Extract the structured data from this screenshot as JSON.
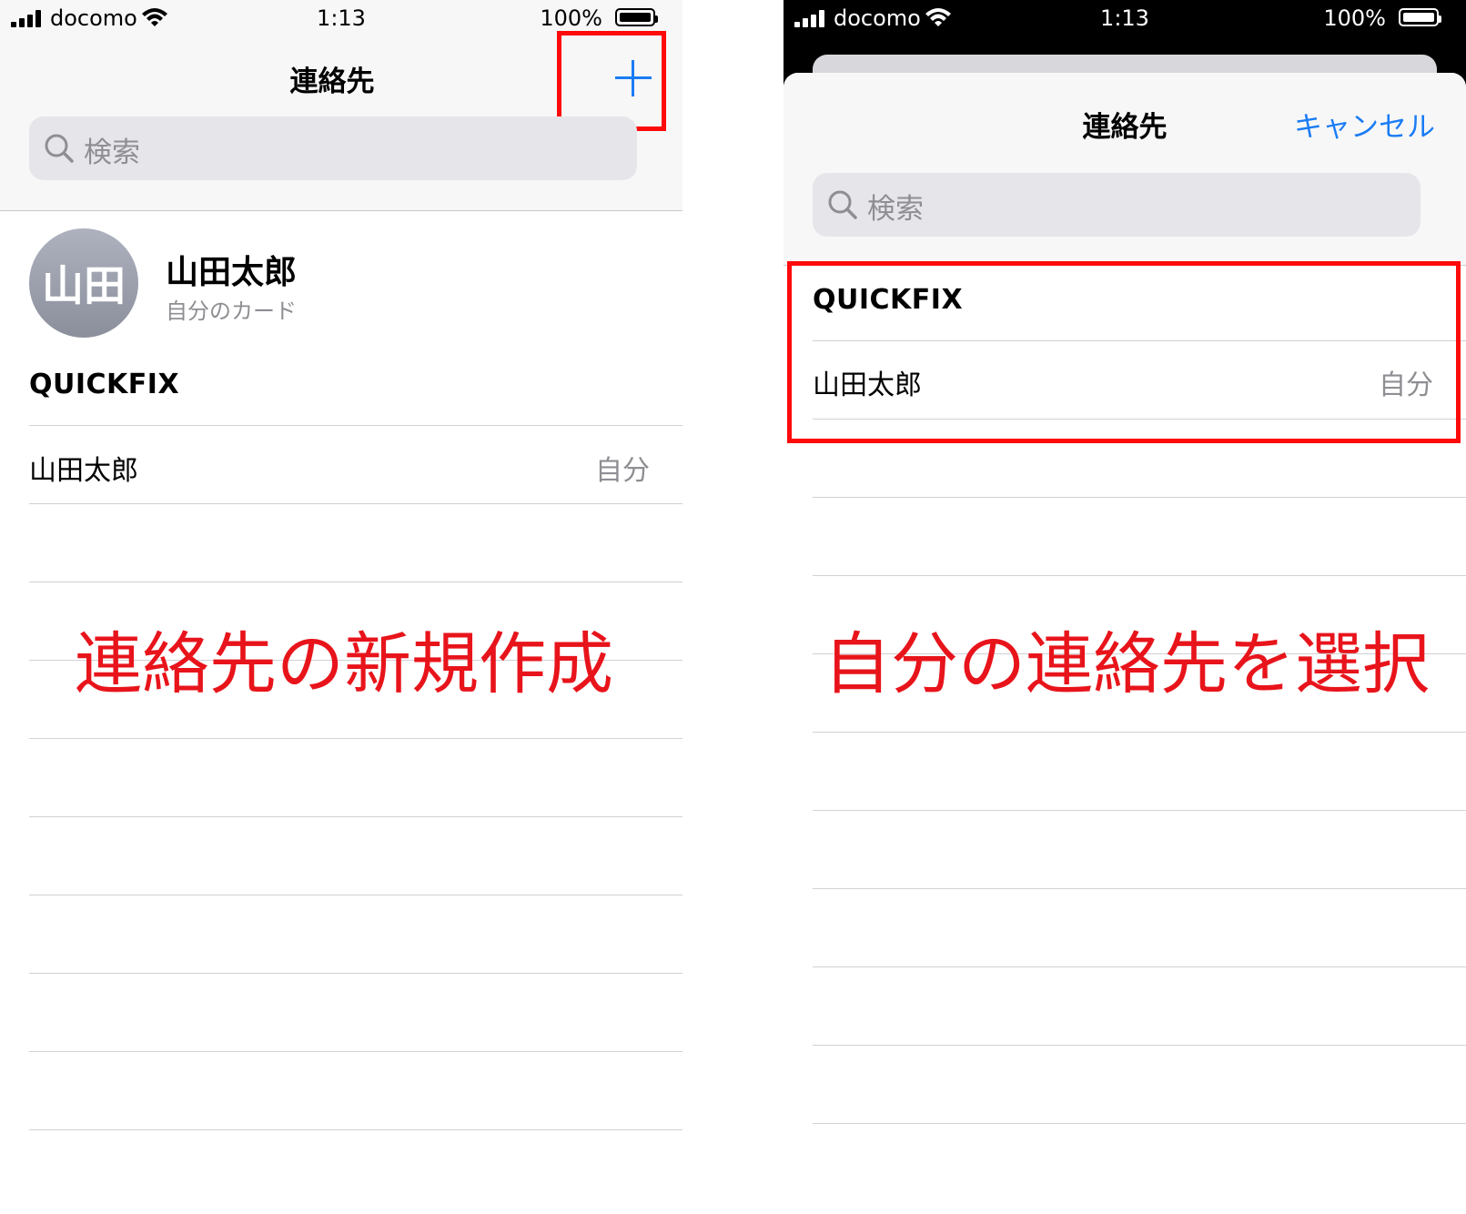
{
  "status": {
    "carrier": "docomo",
    "time": "1:13",
    "battery": "100%"
  },
  "left": {
    "title": "連絡先",
    "search_placeholder": "検索",
    "my_card": {
      "avatar_initials": "山田",
      "name": "山田太郎",
      "subtitle": "自分のカード"
    },
    "group": "QUICKFIX",
    "contact": {
      "name": "山田太郎",
      "badge": "自分"
    },
    "caption": "連絡先の新規作成"
  },
  "right": {
    "title": "連絡先",
    "cancel": "キャンセル",
    "search_placeholder": "検索",
    "group": "QUICKFIX",
    "contact": {
      "name": "山田太郎",
      "badge": "自分"
    },
    "caption": "自分の連絡先を選択"
  },
  "colors": {
    "accent": "#1a7cf5",
    "highlight": "#ff0a0a",
    "caption": "#e8141b"
  }
}
